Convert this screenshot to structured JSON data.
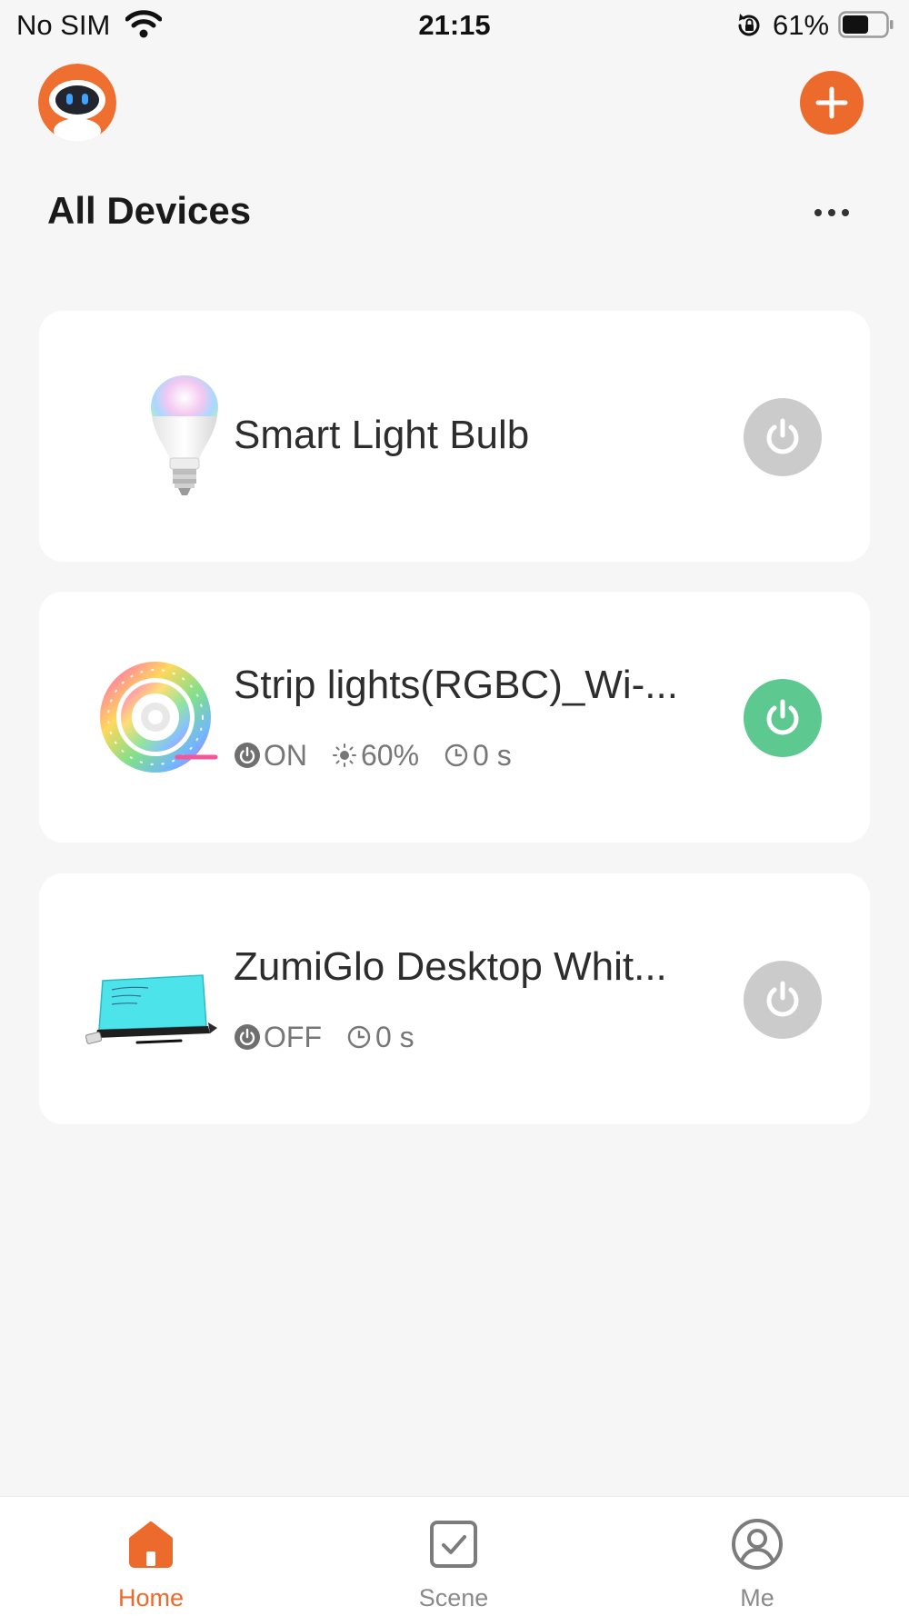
{
  "status_bar": {
    "carrier": "No SIM",
    "time": "21:15",
    "battery_percent": "61%",
    "battery_level": 0.61,
    "icons": [
      "wifi-icon",
      "rotation-lock-icon",
      "battery-icon"
    ]
  },
  "header": {
    "avatar_icon": "robot-avatar-icon",
    "add_icon": "plus-icon",
    "title": "All Devices",
    "more_icon": "ellipsis-icon"
  },
  "colors": {
    "accent": "#ec6a2c",
    "power_on": "#5dc890",
    "power_off": "#cbcbcb",
    "card_background": "#ffffff",
    "page_background": "#f6f6f6"
  },
  "devices": [
    {
      "name": "Smart Light Bulb",
      "image_icon": "light-bulb-icon",
      "power_state": "off"
    },
    {
      "name": "Strip lights(RGBC)_Wi-...",
      "image_icon": "led-strip-icon",
      "power_state": "on",
      "power_label": "ON",
      "brightness": "60%",
      "timer": "0 s"
    },
    {
      "name": "ZumiGlo Desktop Whit...",
      "image_icon": "desktop-whiteboard-icon",
      "power_state": "off",
      "power_label": "OFF",
      "timer": "0 s"
    }
  ],
  "tabs": [
    {
      "label": "Home",
      "icon": "home-icon",
      "active": true
    },
    {
      "label": "Scene",
      "icon": "scene-checkbox-icon",
      "active": false
    },
    {
      "label": "Me",
      "icon": "user-profile-icon",
      "active": false
    }
  ]
}
